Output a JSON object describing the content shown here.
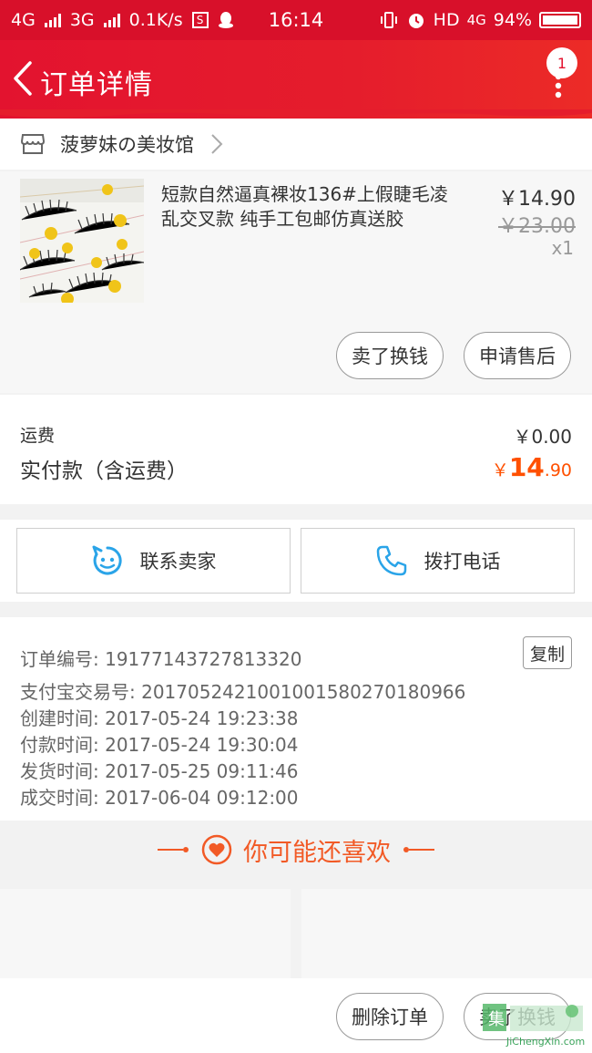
{
  "status_bar": {
    "net1": "4G",
    "net2": "3G",
    "speed": "0.1K/s",
    "time": "16:14",
    "hd": "HD",
    "net3": "4G",
    "battery": "94%"
  },
  "header": {
    "title": "订单详情",
    "badge_count": "1"
  },
  "shop": {
    "name": "菠萝妹の美妆馆"
  },
  "product": {
    "title": "短款自然逼真裸妆136#上假睫毛凌乱交叉款 纯手工包邮仿真送胶",
    "price": "￥14.90",
    "original_price": "￥23.00",
    "quantity": "x1",
    "sell_button": "卖了换钱",
    "after_sale_button": "申请售后"
  },
  "fees": {
    "shipping_label": "运费",
    "shipping_value": "￥0.00",
    "paid_label": "实付款（含运费）",
    "paid_currency": "￥",
    "paid_integer": "14",
    "paid_decimal": ".90"
  },
  "contacts": {
    "seller_label": "联系卖家",
    "phone_label": "拨打电话"
  },
  "order_info": {
    "order_no": "订单编号: 19177143727813320",
    "copy_label": "复制",
    "alipay_no": "支付宝交易号: 2017052421001001580270180966",
    "created": "创建时间: 2017-05-24 19:23:38",
    "paid": "付款时间: 2017-05-24 19:30:04",
    "shipped": "发货时间: 2017-05-25 09:11:46",
    "completed": "成交时间: 2017-06-04 09:12:00"
  },
  "recommend": {
    "title": "你可能还喜欢"
  },
  "bottom_bar": {
    "delete_label": "删除订单",
    "sell_label": "卖了换钱"
  },
  "watermark": {
    "text": "JiChengXin.com"
  },
  "colors": {
    "header_red": "#e3132f",
    "price_orange": "#ff5000",
    "recommend_orange": "#f25a26",
    "icon_blue": "#2aa4e8"
  }
}
